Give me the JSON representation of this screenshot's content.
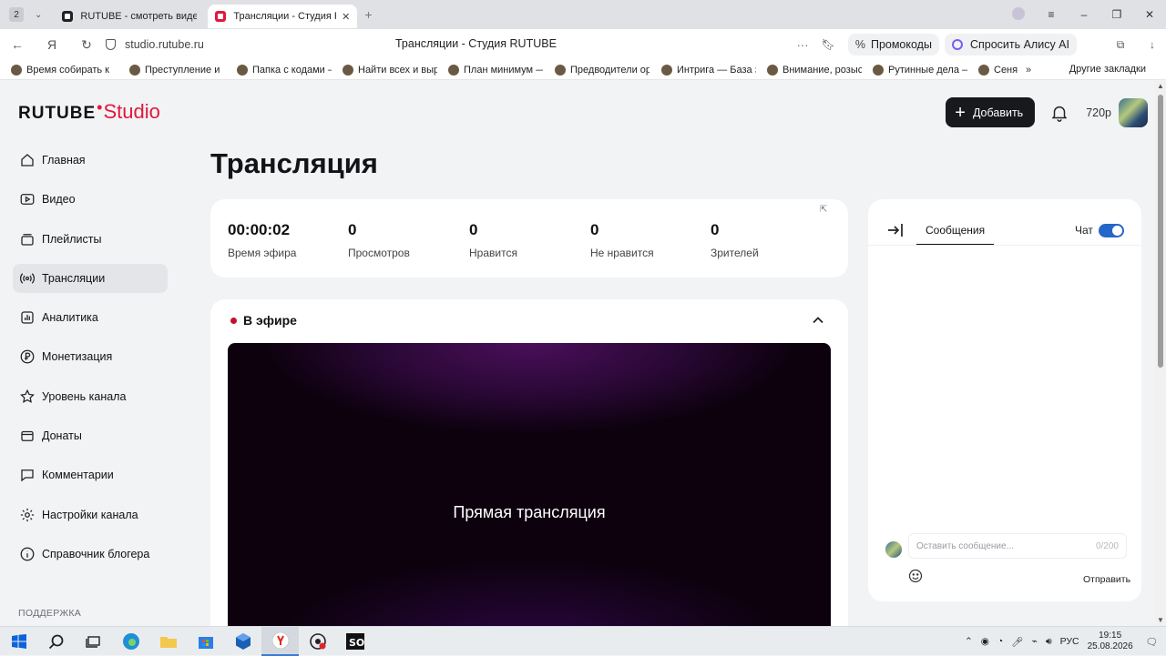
{
  "browser": {
    "tab_count": "2",
    "tabs": [
      {
        "title": "RUTUBE - смотреть видео"
      },
      {
        "title": "Трансляции - Студия RUTUBE"
      }
    ],
    "url": "studio.rutube.ru",
    "page_title": "Трансляции - Студия RUTUBE",
    "promo_label": "Промокоды",
    "alice_label": "Спросить Алису AI",
    "bookmarks": [
      "Время собирать к",
      "Преступление и",
      "Папка с кодами —",
      "Найти всех и выр",
      "План минимум —",
      "Предводители ор",
      "Интрига — База з",
      "Внимание, розыс",
      "Рутинные дела —",
      "Сеня"
    ],
    "other_bookmarks": "Другие закладки"
  },
  "app": {
    "logo_main": "RUTUBE",
    "logo_studio": "Studio",
    "add_button": "Добавить",
    "quality": "720p",
    "sidebar": [
      {
        "label": "Главная",
        "icon": "home-icon"
      },
      {
        "label": "Видео",
        "icon": "video-icon"
      },
      {
        "label": "Плейлисты",
        "icon": "playlist-icon"
      },
      {
        "label": "Трансляции",
        "icon": "broadcast-icon",
        "active": true
      },
      {
        "label": "Аналитика",
        "icon": "analytics-icon"
      },
      {
        "label": "Монетизация",
        "icon": "ruble-icon"
      },
      {
        "label": "Уровень канала",
        "icon": "star-icon"
      },
      {
        "label": "Донаты",
        "icon": "donate-icon"
      },
      {
        "label": "Комментарии",
        "icon": "comment-icon"
      },
      {
        "label": "Настройки канала",
        "icon": "gear-icon"
      },
      {
        "label": "Справочник блогера",
        "icon": "info-icon"
      }
    ],
    "support_label": "ПОДДЕРЖКА",
    "page_title": "Трансляция",
    "stats": [
      {
        "value": "00:00:02",
        "label": "Время эфира"
      },
      {
        "value": "0",
        "label": "Просмотров"
      },
      {
        "value": "0",
        "label": "Нравится"
      },
      {
        "value": "0",
        "label": "Не нравится"
      },
      {
        "value": "0",
        "label": "Зрителей"
      }
    ],
    "live_label": "В эфире",
    "player_text": "Прямая трансляция",
    "chat": {
      "tab_label": "Сообщения",
      "toggle_label": "Чат",
      "toggle_on": true,
      "input_placeholder": "Оставить сообщение...",
      "counter": "0/200",
      "send_label": "Отправить"
    }
  },
  "taskbar": {
    "language": "РУС",
    "time": "19:15",
    "date": "25.08.2026"
  },
  "colors": {
    "accent_red": "#e2173c",
    "toggle_blue": "#2566c9",
    "button_dark": "#18191c"
  }
}
